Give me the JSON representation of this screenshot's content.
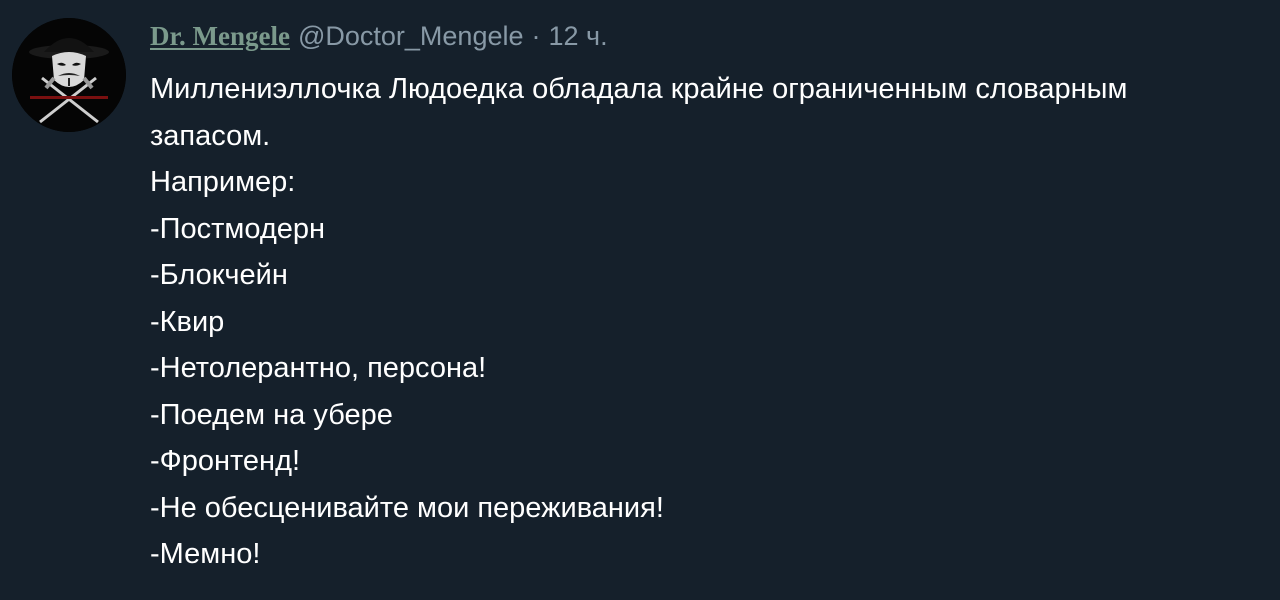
{
  "tweet": {
    "author": {
      "display_name": "Dr. Mengele",
      "handle": "@Doctor_Mengele"
    },
    "separator": "·",
    "time": "12 ч.",
    "lines": [
      "Миллениэллочка Людоедка обладала крайне ограниченным словарным",
      "запасом.",
      "Например:",
      "-Постмодерн",
      "-Блокчейн",
      "-Квир",
      "-Нетолерантно, персона!",
      "-Поедем на убере",
      "-Фронтенд!",
      "-Не обесценивайте мои переживания!",
      "-Мемно!"
    ]
  },
  "colors": {
    "background": "#15202b",
    "text": "#ffffff",
    "secondary_text": "#8899a6",
    "display_name": "#7b9a8c"
  },
  "icons": {
    "avatar": "masked-figure-crossed-daggers-avatar"
  }
}
